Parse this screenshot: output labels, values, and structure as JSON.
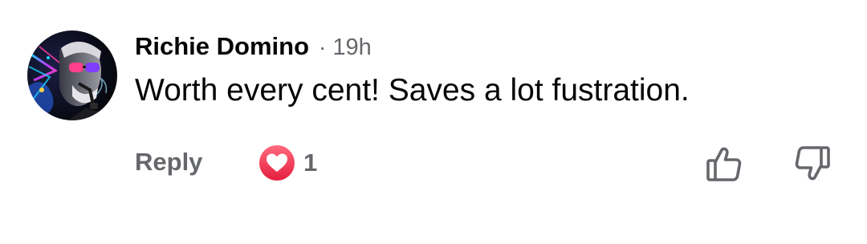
{
  "comment": {
    "author": "Richie Domino",
    "separator": "·",
    "time": "19h",
    "text": "Worth every cent! Saves a lot fustration.",
    "actions": {
      "reply_label": "Reply",
      "reaction_count": "1",
      "reaction_type": "love-icon",
      "upvote_icon": "thumbs-up-icon",
      "downvote_icon": "thumbs-down-icon"
    }
  },
  "colors": {
    "text_primary": "#050505",
    "text_secondary": "#65676b",
    "love_reaction": "#f0304a"
  }
}
